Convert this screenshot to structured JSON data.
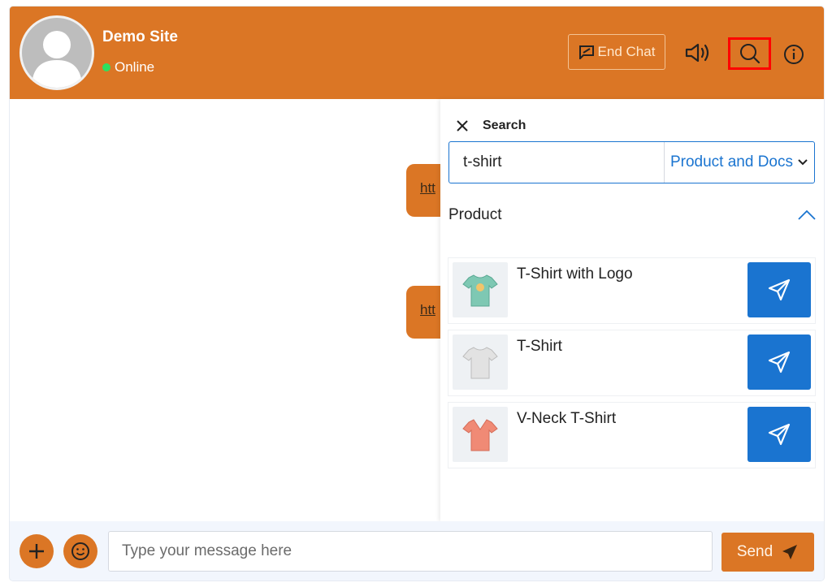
{
  "header": {
    "site_name": "Demo Site",
    "status": "Online",
    "end_chat_label": "End Chat"
  },
  "colors": {
    "brand": "#db7625",
    "accent": "#1a74d0",
    "online": "#2ee05f",
    "highlight": "#ff0000"
  },
  "messages": [
    {
      "text": "htt"
    },
    {
      "text": "htt"
    }
  ],
  "search_panel": {
    "title": "Search",
    "query": "t-shirt",
    "scope": "Product and Docs",
    "section_title": "Product",
    "products": [
      {
        "name": "T-Shirt with Logo",
        "thumb_color": "#7ec8b3"
      },
      {
        "name": "T-Shirt",
        "thumb_color": "#e2e2e2"
      },
      {
        "name": "V-Neck T-Shirt",
        "thumb_color": "#f08a75"
      }
    ]
  },
  "footer": {
    "input_placeholder": "Type your message here",
    "send_label": "Send"
  },
  "icons": {
    "end_chat": "chat-off-icon",
    "speaker": "speaker-icon",
    "search": "search-icon",
    "info": "info-icon",
    "close": "close-icon",
    "chevron_down": "chevron-down-icon",
    "chevron_up": "chevron-up-icon",
    "send": "paper-plane-icon",
    "plus": "plus-icon",
    "emoji": "emoji-icon"
  }
}
